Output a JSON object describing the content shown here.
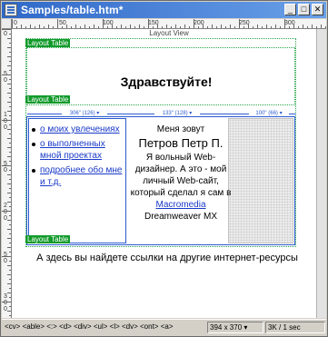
{
  "window": {
    "title": "Samples/table.htm*",
    "buttons": [
      "_",
      "□",
      "✕"
    ]
  },
  "ruler": {
    "h_numbers": [
      "0",
      "50",
      "100",
      "150",
      "200",
      "250",
      "300"
    ],
    "v_numbers": [
      "0",
      "5",
      "0",
      "1",
      "0",
      "0",
      "5",
      "0",
      "2",
      "0",
      "0",
      "5",
      "0",
      "3",
      "0",
      "0"
    ]
  },
  "design": {
    "view_label": "Layout View",
    "layout_table_label": "Layout Table",
    "greeting": "Здравствуйте!",
    "column_widths": [
      "306\" (126) ▾",
      "133\" (128) ▾",
      "100\" (66) ▾"
    ],
    "nav_links": [
      "о моих увлечениях",
      "о выполненных мной проектах",
      "подробнее обо мне и т.д."
    ],
    "bio_lines": [
      "Меня зовут",
      "Петров Петр П.",
      "Я вольный Web-дизайнер. А это - мой личный Web-сайт, который сделал я сам в",
      "Macromedia",
      "Dreamweaver MX"
    ],
    "footer_text": "А здесь вы найдете ссылки на другие интернет-ресурсы"
  },
  "statusbar": {
    "tag_selector": "<cv> <able> <:> <d> <div> <ul> <l> <dv> <ont> <a>",
    "window_size": "394 x 370 ▾",
    "download": "3K / 1 sec"
  }
}
